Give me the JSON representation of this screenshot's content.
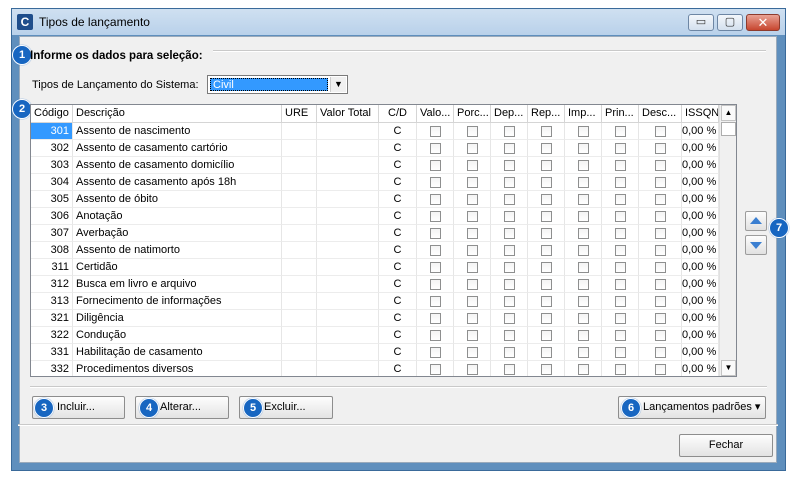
{
  "window": {
    "title": "Tipos de lançamento",
    "app_icon_letter": "C",
    "controls": {
      "minimize": "▭",
      "maximize": "▢",
      "close": "✕"
    }
  },
  "section": {
    "title": "Informe os dados para seleção:",
    "badge": "1"
  },
  "filter": {
    "label": "Tipos de Lançamento do Sistema:",
    "selected_value": "Civil",
    "arrow": "▼"
  },
  "grid": {
    "badge": "2",
    "columns": [
      "Código",
      "Descrição",
      "URE",
      "Valor Total",
      "C/D",
      "Valo...",
      "Porc...",
      "Dep...",
      "Rep...",
      "Imp...",
      "Prin...",
      "Desc...",
      "ISSQN"
    ],
    "rows": [
      {
        "code": "301",
        "description": "Assento de nascimento",
        "cd": "C",
        "issqn": "0,00 %"
      },
      {
        "code": "302",
        "description": "Assento de casamento cartório",
        "cd": "C",
        "issqn": "0,00 %"
      },
      {
        "code": "303",
        "description": "Assento de casamento domicílio",
        "cd": "C",
        "issqn": "0,00 %"
      },
      {
        "code": "304",
        "description": "Assento de casamento após 18h",
        "cd": "C",
        "issqn": "0,00 %"
      },
      {
        "code": "305",
        "description": "Assento de óbito",
        "cd": "C",
        "issqn": "0,00 %"
      },
      {
        "code": "306",
        "description": "Anotação",
        "cd": "C",
        "issqn": "0,00 %"
      },
      {
        "code": "307",
        "description": "Averbação",
        "cd": "C",
        "issqn": "0,00 %"
      },
      {
        "code": "308",
        "description": "Assento de natimorto",
        "cd": "C",
        "issqn": "0,00 %"
      },
      {
        "code": "311",
        "description": "Certidão",
        "cd": "C",
        "issqn": "0,00 %"
      },
      {
        "code": "312",
        "description": "Busca em livro e arquivo",
        "cd": "C",
        "issqn": "0,00 %"
      },
      {
        "code": "313",
        "description": "Fornecimento de informações",
        "cd": "C",
        "issqn": "0,00 %"
      },
      {
        "code": "321",
        "description": "Diligência",
        "cd": "C",
        "issqn": "0,00 %"
      },
      {
        "code": "322",
        "description": "Condução",
        "cd": "C",
        "issqn": "0,00 %"
      },
      {
        "code": "331",
        "description": "Habilitação de casamento",
        "cd": "C",
        "issqn": "0,00 %"
      },
      {
        "code": "332",
        "description": "Procedimentos diversos",
        "cd": "C",
        "issqn": "0,00 %"
      }
    ],
    "scroll_up": "▲",
    "scroll_down": "▼"
  },
  "reorder": {
    "badge": "7"
  },
  "buttons": {
    "incluir": {
      "label": "Incluir...",
      "badge": "3"
    },
    "alterar": {
      "label": "Alterar...",
      "badge": "4"
    },
    "excluir": {
      "label": "Excluir...",
      "badge": "5"
    },
    "lancamentos": {
      "label": "Lançamentos padrões ▾",
      "badge": "6"
    },
    "fechar": {
      "label": "Fechar"
    }
  },
  "colors": {
    "badge": "#1766c1",
    "selection": "#3399ff",
    "arrow_blue": "#3b7fd1"
  }
}
